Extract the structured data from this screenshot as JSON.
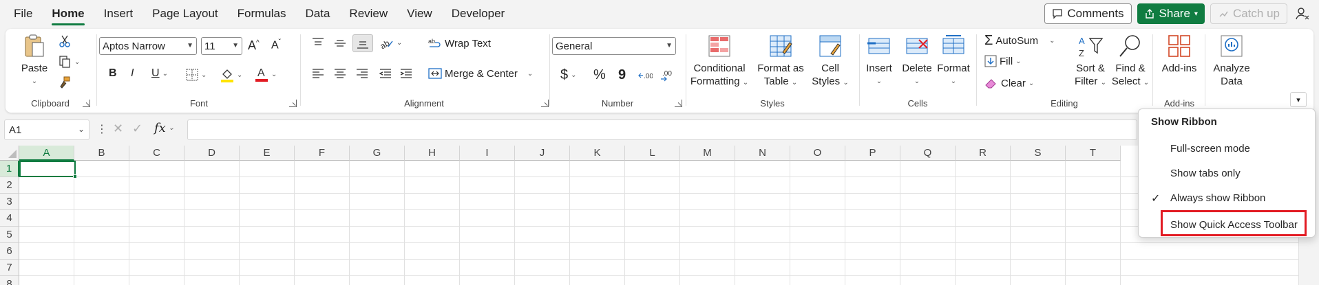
{
  "menubar": {
    "tabs": [
      "File",
      "Home",
      "Insert",
      "Page Layout",
      "Formulas",
      "Data",
      "Review",
      "View",
      "Developer"
    ],
    "active": "Home",
    "comments_label": "Comments",
    "share_label": "Share",
    "catchup_label": "Catch up"
  },
  "ribbon": {
    "clipboard": {
      "label": "Clipboard",
      "paste": "Paste"
    },
    "font": {
      "label": "Font",
      "name": "Aptos Narrow",
      "size": "11"
    },
    "alignment": {
      "label": "Alignment",
      "wrap": "Wrap Text",
      "merge": "Merge & Center"
    },
    "number": {
      "label": "Number",
      "format": "General"
    },
    "styles": {
      "label": "Styles",
      "conditional_1": "Conditional",
      "conditional_2": "Formatting",
      "table_1": "Format as",
      "table_2": "Table",
      "cell_1": "Cell",
      "cell_2": "Styles"
    },
    "cells": {
      "label": "Cells",
      "insert": "Insert",
      "delete": "Delete",
      "format": "Format"
    },
    "editing": {
      "label": "Editing",
      "autosum": "AutoSum",
      "fill": "Fill",
      "clear": "Clear",
      "sort_1": "Sort &",
      "sort_2": "Filter",
      "find_1": "Find &",
      "find_2": "Select"
    },
    "addins": {
      "label": "Add-ins",
      "button": "Add-ins"
    },
    "analyze": {
      "line1": "Analyze",
      "line2": "Data"
    }
  },
  "formulabar": {
    "cell_ref": "A1",
    "fx": "fx"
  },
  "grid": {
    "columns": [
      "A",
      "B",
      "C",
      "D",
      "E",
      "F",
      "G",
      "H",
      "I",
      "J",
      "K",
      "L",
      "M",
      "N",
      "O",
      "P",
      "Q",
      "R",
      "S",
      "T"
    ],
    "rows": [
      "1",
      "2",
      "3",
      "4",
      "5",
      "6",
      "7",
      "8"
    ]
  },
  "ribbon_menu": {
    "title": "Show Ribbon",
    "items": [
      "Full-screen mode",
      "Show tabs only",
      "Always show Ribbon",
      "Show Quick Access Toolbar"
    ]
  },
  "colors": {
    "accent": "#107c41",
    "highlight": "#e21b23"
  }
}
